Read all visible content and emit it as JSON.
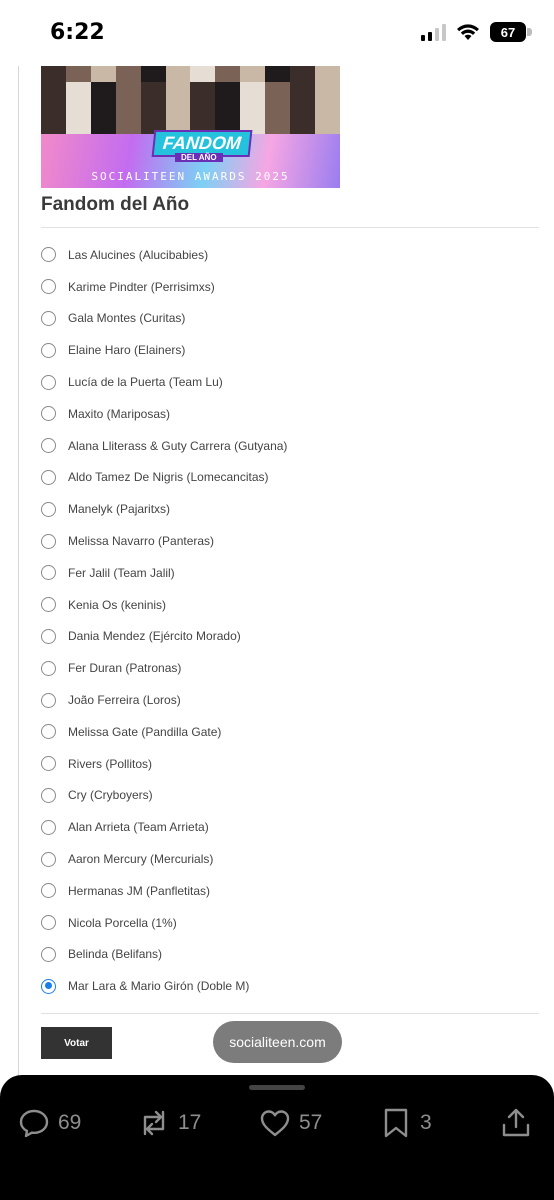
{
  "status_bar": {
    "time": "6:22",
    "battery": "67"
  },
  "banner": {
    "title": "FANDOM",
    "subtitle": "DEL AÑO",
    "caption": "SOCIALITEEN AWARDS 2025"
  },
  "poll": {
    "title": "Fandom del Año",
    "options": [
      {
        "label": "Las Alucines (Alucibabies)",
        "selected": false
      },
      {
        "label": "Karime Pindter (Perrisimxs)",
        "selected": false
      },
      {
        "label": "Gala Montes (Curitas)",
        "selected": false
      },
      {
        "label": "Elaine Haro (Elainers)",
        "selected": false
      },
      {
        "label": "Lucía de la Puerta (Team Lu)",
        "selected": false
      },
      {
        "label": "Maxito (Mariposas)",
        "selected": false
      },
      {
        "label": "Alana Lliterass & Guty Carrera (Gutyana)",
        "selected": false
      },
      {
        "label": "Aldo Tamez De Nigris (Lomecancitas)",
        "selected": false
      },
      {
        "label": "Manelyk (Pajaritxs)",
        "selected": false
      },
      {
        "label": "Melissa Navarro (Panteras)",
        "selected": false
      },
      {
        "label": "Fer Jalil (Team Jalil)",
        "selected": false
      },
      {
        "label": "Kenia Os (keninis)",
        "selected": false
      },
      {
        "label": "Dania Mendez (Ejército Morado)",
        "selected": false
      },
      {
        "label": "Fer Duran (Patronas)",
        "selected": false
      },
      {
        "label": "João Ferreira (Loros)",
        "selected": false
      },
      {
        "label": "Melissa Gate (Pandilla Gate)",
        "selected": false
      },
      {
        "label": "Rivers (Pollitos)",
        "selected": false
      },
      {
        "label": "Cry (Cryboyers)",
        "selected": false
      },
      {
        "label": "Alan Arrieta (Team Arrieta)",
        "selected": false
      },
      {
        "label": "Aaron Mercury (Mercurials)",
        "selected": false
      },
      {
        "label": "Hermanas JM (Panfletitas)",
        "selected": false
      },
      {
        "label": "Nicola Porcella (1%)",
        "selected": false
      },
      {
        "label": "Belinda (Belifans)",
        "selected": false
      },
      {
        "label": "Mar Lara & Mario Girón (Doble M)",
        "selected": true
      }
    ],
    "vote_label": "Votar"
  },
  "toast": "socialiteen.com",
  "actions": {
    "replies": "69",
    "reposts": "17",
    "likes": "57",
    "bookmarks": "3"
  }
}
